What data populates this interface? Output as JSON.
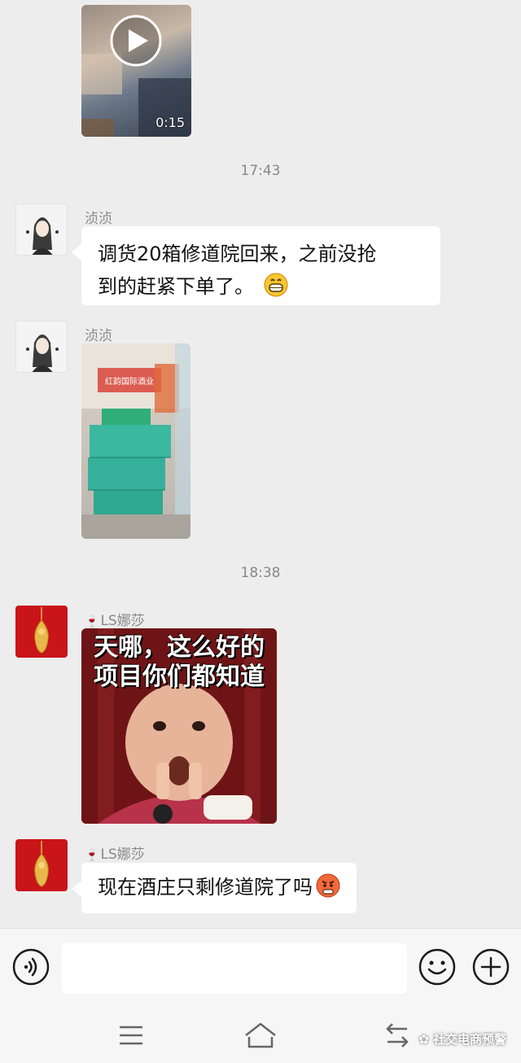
{
  "messages": [
    {
      "type": "video",
      "duration": "0:15"
    },
    {
      "type": "time",
      "text": "17:43"
    },
    {
      "type": "text",
      "sender": "浈浈",
      "text_line1": "调货20箱修道院回来，之前没抢",
      "text_line2": "到的赶紧下单了。",
      "emoji": "grin-emoji"
    },
    {
      "type": "image",
      "sender": "浈浈",
      "store_sign": "红韵国际酒业"
    },
    {
      "type": "time",
      "text": "18:38"
    },
    {
      "type": "sticker",
      "sender": "LS娜莎",
      "caption_line1": "天哪，这么好的",
      "caption_line2": "项目你们都知道"
    },
    {
      "type": "text",
      "sender": "LS娜莎",
      "text": "现在酒庄只剩修道院了吗",
      "emoji": "angry-emoji"
    }
  ],
  "input": {
    "placeholder": ""
  },
  "watermark": "社交电商预警",
  "colors": {
    "background": "#ededed",
    "bubble": "#ffffff",
    "accent_red": "#c9141a"
  }
}
